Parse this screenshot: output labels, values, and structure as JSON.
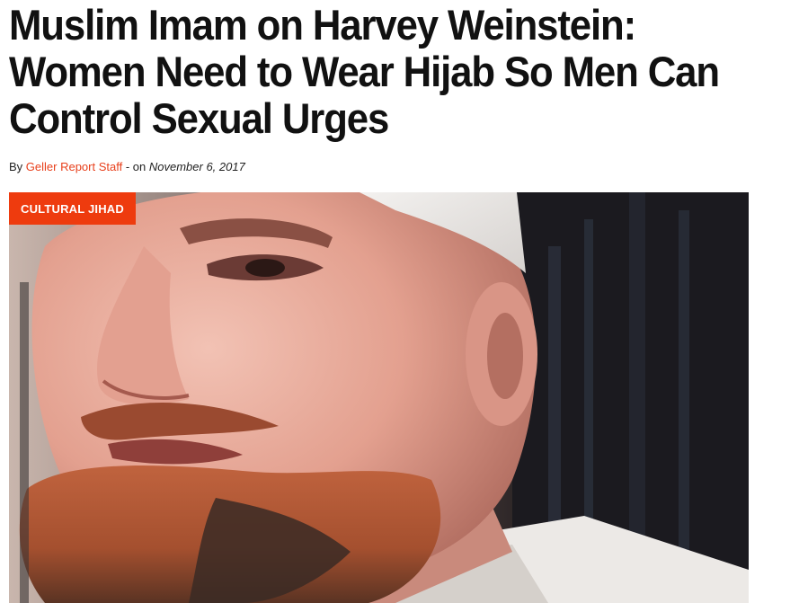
{
  "article": {
    "title": "Muslim Imam on Harvey Weinstein: Women Need to Wear Hijab So Men Can Control Sexual Urges",
    "byline": {
      "prefix": "By",
      "author": "Geller Report Staff",
      "separator": "- on",
      "date": "November 6, 2017"
    },
    "category": "CULTURAL JIHAD",
    "image": {
      "subject": "photo of bearded man wearing white cap"
    }
  },
  "colors": {
    "accent": "#ee3b0e",
    "author_link": "#e8401c",
    "headline": "#111111"
  }
}
